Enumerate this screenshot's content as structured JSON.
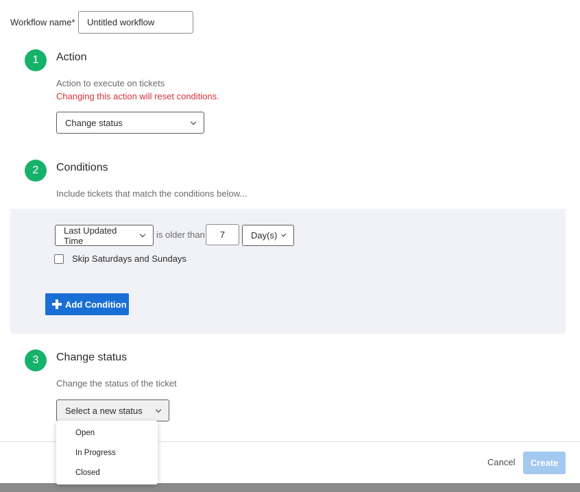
{
  "workflow": {
    "label": "Workflow name*",
    "value": "Untitled workflow"
  },
  "step1": {
    "number": "1",
    "title": "Action",
    "description": "Action to execute on tickets",
    "warning": "Changing this action will reset conditions.",
    "select_value": "Change status"
  },
  "step2": {
    "number": "2",
    "title": "Conditions",
    "description": "Include tickets that match the conditions below...",
    "condition": {
      "field": "Last Updated Time",
      "operator": "is older than",
      "amount": "7",
      "unit": "Day(s)"
    },
    "skip_weekends_label": "Skip Saturdays and Sundays",
    "skip_weekends_checked": false,
    "add_condition_label": "Add Condition"
  },
  "step3": {
    "number": "3",
    "title": "Change status",
    "description": "Change the status of the ticket",
    "select_placeholder": "Select a new status",
    "options": [
      "Open",
      "In Progress",
      "Closed"
    ]
  },
  "footer": {
    "cancel_label": "Cancel",
    "create_label": "Create"
  },
  "colors": {
    "step_green": "#17b26a",
    "primary_blue": "#1a6fd6",
    "disabled_blue": "#a4c9f0",
    "warning_red": "#d0333a",
    "panel_bg": "#f1f2f7"
  }
}
